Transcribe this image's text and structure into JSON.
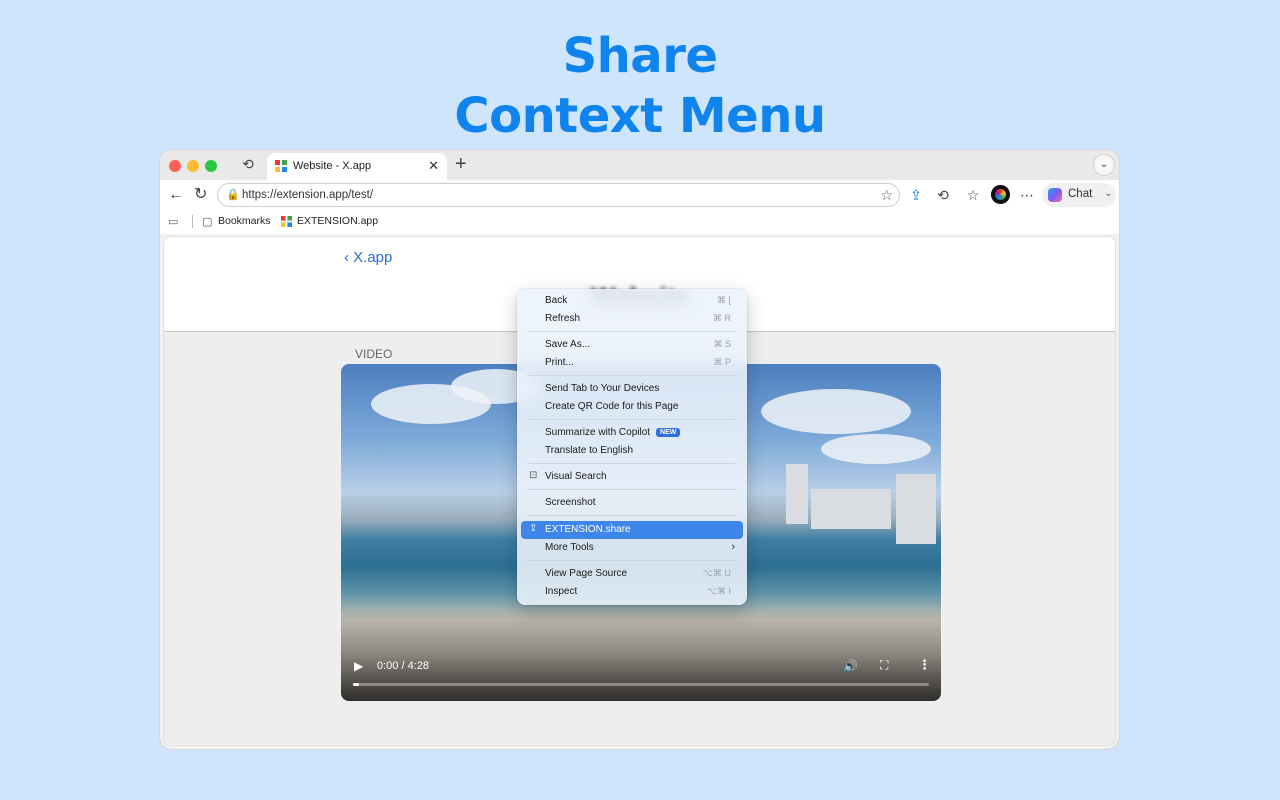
{
  "hero": {
    "line1": "Share",
    "line2": "Context Menu"
  },
  "browser": {
    "tab": {
      "title": "Website - X.app",
      "close": "✕"
    },
    "new_tab": "+",
    "address": {
      "url": "https://extension.app/test/"
    },
    "chat_label": "Chat",
    "bookmarks": [
      {
        "label": "Bookmarks"
      },
      {
        "label": "EXTENSION.app"
      }
    ]
  },
  "page": {
    "back_link": "X.app",
    "title": "Website",
    "video_label": "VIDEO",
    "video": {
      "time": "0:00 / 4:28",
      "progress": 0.0
    }
  },
  "context_menu": {
    "items": [
      {
        "label": "Back",
        "shortcut": "⌘ ["
      },
      {
        "label": "Refresh",
        "shortcut": "⌘ R"
      },
      {
        "label": "Save As...",
        "shortcut": "⌘ S"
      },
      {
        "label": "Print...",
        "shortcut": "⌘ P"
      },
      {
        "label": "Send Tab to Your Devices",
        "shortcut": ""
      },
      {
        "label": "Create QR Code for this Page",
        "shortcut": ""
      },
      {
        "label": "Summarize with Copilot",
        "shortcut": "",
        "badge": "NEW"
      },
      {
        "label": "Translate to English",
        "shortcut": ""
      },
      {
        "label": "Visual Search",
        "shortcut": "",
        "icon": "visual-search-icon"
      },
      {
        "label": "Screenshot",
        "shortcut": ""
      },
      {
        "label": "EXTENSION.share",
        "shortcut": "",
        "icon": "share-extension-icon",
        "highlighted": true
      },
      {
        "label": "More Tools",
        "shortcut": "",
        "submenu": true
      },
      {
        "label": "View Page Source",
        "shortcut": "⌥⌘ U"
      },
      {
        "label": "Inspect",
        "shortcut": "⌥⌘ I"
      }
    ]
  },
  "colors": {
    "accent": "#0f83ee",
    "highlight": "#3f86ea",
    "background": "#cfe5fb"
  }
}
